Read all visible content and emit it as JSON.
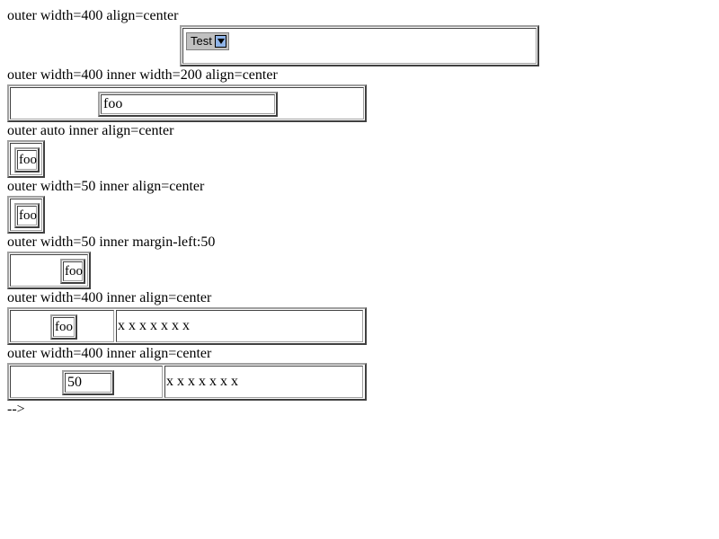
{
  "sections": [
    {
      "label": "outer width=400 align=center",
      "select_value": "Test"
    },
    {
      "label": "outer width=400 inner width=200 align=center",
      "cell_text": "foo"
    },
    {
      "label": "outer auto inner align=center",
      "cell_text": "foo"
    },
    {
      "label": "outer width=50 inner align=center",
      "cell_text": "foo"
    },
    {
      "label": "outer width=50 inner margin-left:50",
      "cell_text": "foo"
    },
    {
      "label": "outer width=400 inner align=center",
      "cell_text": "foo",
      "right_text": "x x x x x x x"
    },
    {
      "label": "outer width=400 inner align=center",
      "cell_text": "50",
      "right_text": "x x x x x x x"
    }
  ],
  "footer_text": "-->",
  "icons": {
    "dropdown": "dropdown-arrow-icon"
  }
}
